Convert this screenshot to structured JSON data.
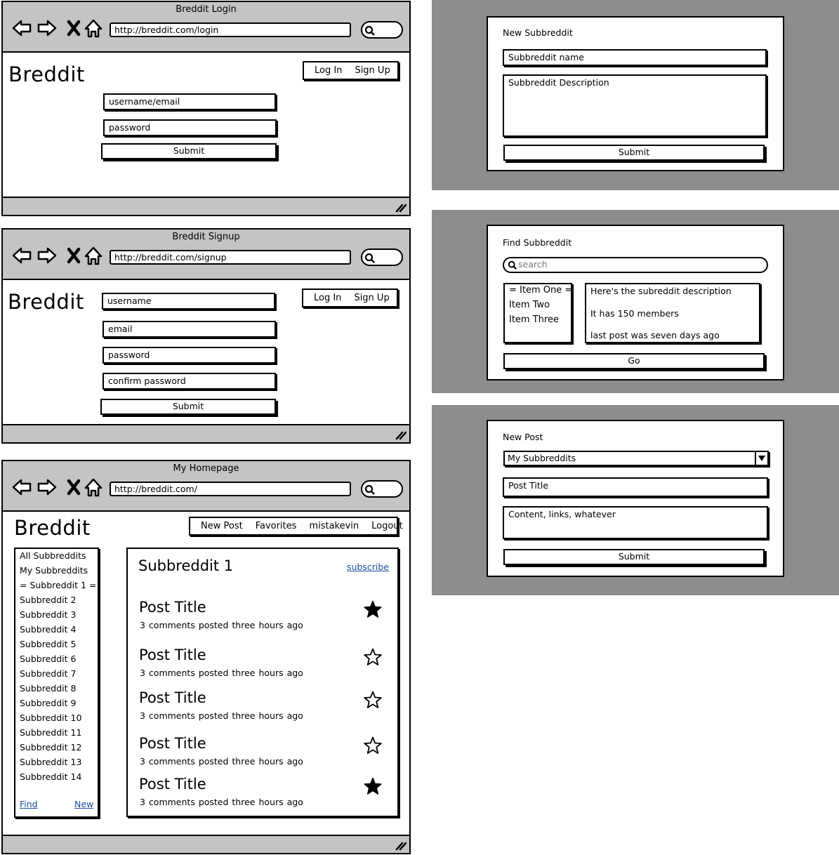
{
  "login": {
    "window_title": "Breddit Login",
    "url": "http://breddit.com/login",
    "logo": "Breddit",
    "nav": {
      "login": "Log In",
      "signup": "Sign Up"
    },
    "username_placeholder": "username/email",
    "password_placeholder": "password",
    "submit": "Submit"
  },
  "signup": {
    "window_title": "Breddit Signup",
    "url": "http://breddit.com/signup",
    "logo": "Breddit",
    "nav": {
      "login": "Log In",
      "signup": "Sign Up"
    },
    "username_placeholder": "username",
    "email_placeholder": "email",
    "password_placeholder": "password",
    "confirm_placeholder": "confirm password",
    "submit": "Submit"
  },
  "homepage": {
    "window_title": "My Homepage",
    "url": "http://breddit.com/",
    "logo": "Breddit",
    "menu": {
      "new_post": "New Post",
      "favorites": "Favorites",
      "user": "mistakevin",
      "logout": "Logout"
    },
    "sidebar": {
      "items": [
        "All Subbreddits",
        "My Subbreddits",
        "= Subbreddit 1 =",
        "Subbreddit 2",
        "Subbreddit 3",
        "Subbreddit 4",
        "Subbreddit 5",
        "Subbreddit 6",
        "Subbreddit 7",
        "Subbreddit 8",
        "Subbreddit 9",
        "Subbreddit 10",
        "Subbreddit 11",
        "Subbreddit 12",
        "Subbreddit 13",
        "Subbreddit 14"
      ],
      "find": "Find",
      "new": "New"
    },
    "main": {
      "title": "Subbreddit 1",
      "subscribe": "subscribe",
      "posts": [
        {
          "title": "Post Title",
          "comments": "3 comments",
          "posted": "posted three hours ago",
          "favorited": true
        },
        {
          "title": "Post Title",
          "comments": "3 comments",
          "posted": "posted three hours ago",
          "favorited": false
        },
        {
          "title": "Post Title",
          "comments": "3 comments",
          "posted": "posted three hours ago",
          "favorited": false
        },
        {
          "title": "Post Title",
          "comments": "3 comments",
          "posted": "posted three hours ago",
          "favorited": false
        },
        {
          "title": "Post Title",
          "comments": "3 comments",
          "posted": "posted three hours ago",
          "favorited": true
        }
      ]
    }
  },
  "new_subbreddit": {
    "title": "New Subbreddit",
    "name_placeholder": "Subbreddit name",
    "description_placeholder": "Subbreddit Description",
    "submit": "Submit"
  },
  "find_subbreddit": {
    "title": "Find Subbreddit",
    "search_placeholder": "search",
    "list": [
      "= Item One =",
      "Item Two",
      "Item Three"
    ],
    "details": [
      "Here's the subreddit description",
      "It has 150 members",
      "last post was seven days ago"
    ],
    "go": "Go"
  },
  "new_post": {
    "title": "New Post",
    "select_value": "My Subbreddits",
    "title_placeholder": "Post Title",
    "content_placeholder": "Content, links, whatever",
    "submit": "Submit"
  },
  "colors": {
    "chrome": "#c4c4c4",
    "panel_bg": "#8d8d8d",
    "link": "#1a4e9c"
  }
}
